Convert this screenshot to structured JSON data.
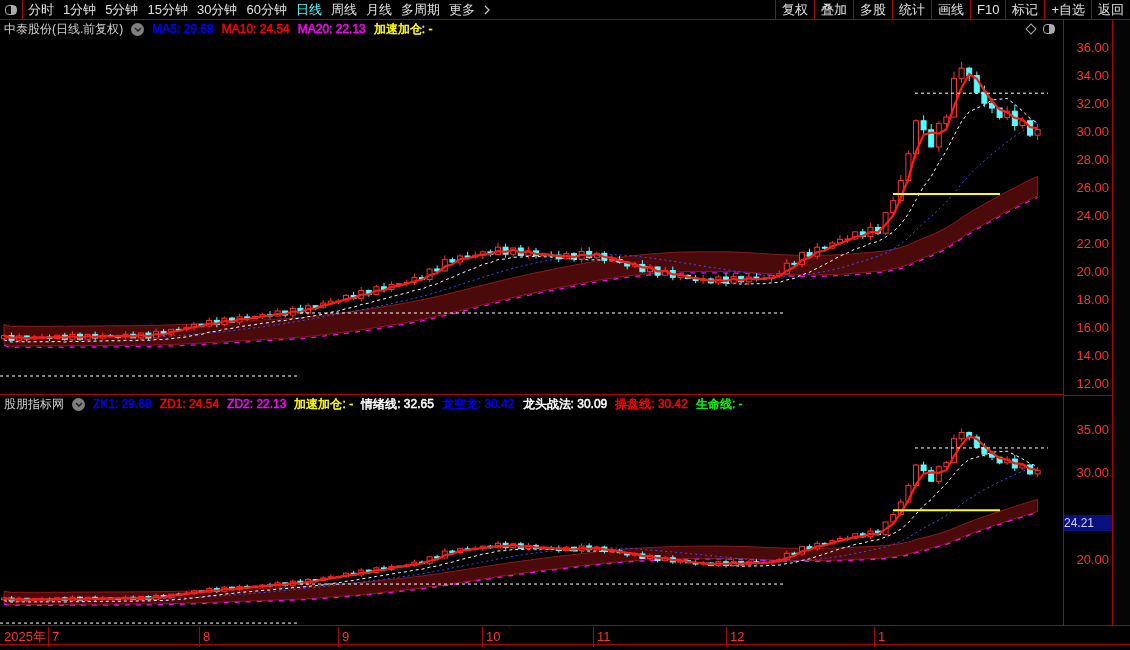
{
  "toolbar": {
    "tabs": [
      {
        "label": "分时",
        "selected": false
      },
      {
        "label": "1分钟",
        "selected": false
      },
      {
        "label": "5分钟",
        "selected": false
      },
      {
        "label": "15分钟",
        "selected": false
      },
      {
        "label": "30分钟",
        "selected": false
      },
      {
        "label": "60分钟",
        "selected": false
      },
      {
        "label": "日线",
        "selected": true
      },
      {
        "label": "周线",
        "selected": false
      },
      {
        "label": "月线",
        "selected": false
      },
      {
        "label": "多周期",
        "selected": false
      },
      {
        "label": "更多",
        "selected": false
      }
    ],
    "actions": [
      "复权",
      "叠加",
      "多股",
      "统计",
      "画线",
      "F10",
      "标记",
      "+自选",
      "返回"
    ]
  },
  "main_panel": {
    "title": "中泰股份(日线.前复权)",
    "indicators": [
      {
        "text": "MA5: 29.68",
        "color": "#0000ff"
      },
      {
        "text": "MA10: 24.54",
        "color": "#ff0000"
      },
      {
        "text": "MA20: 22.13",
        "color": "#ff00ff"
      },
      {
        "text": "加速加仓: -",
        "color": "#ffff00"
      }
    ],
    "y_axis": [
      "36.00",
      "34.00",
      "32.00",
      "30.00",
      "28.00",
      "26.00",
      "24.00",
      "22.00",
      "20.00",
      "18.00",
      "16.00",
      "14.00",
      "12.00"
    ]
  },
  "sub_panel": {
    "title": "股朋指标网",
    "indicators": [
      {
        "text": "ZK1: 29.68",
        "color": "#0000ff"
      },
      {
        "text": "ZD1: 24.54",
        "color": "#ff0000"
      },
      {
        "text": "ZD2: 22.13",
        "color": "#ff00ff"
      },
      {
        "text": "加速加仓: -",
        "color": "#ffff00"
      },
      {
        "text": "情绪线: 32.65",
        "color": "#ffffff"
      },
      {
        "text": "龙空龙: 30.42",
        "color": "#0000ff"
      },
      {
        "text": "龙头战法: 30.09",
        "color": "#ffffff"
      },
      {
        "text": "操盘线: 30.42",
        "color": "#ff0000"
      },
      {
        "text": "生命线: -",
        "color": "#00ff00"
      }
    ],
    "y_axis": [
      "35.00",
      "30.00",
      "20.00"
    ],
    "marker": "24.21"
  },
  "date_axis": {
    "year": "2025年",
    "months": [
      "7",
      "8",
      "9",
      "10",
      "11",
      "12",
      "1"
    ]
  }
}
